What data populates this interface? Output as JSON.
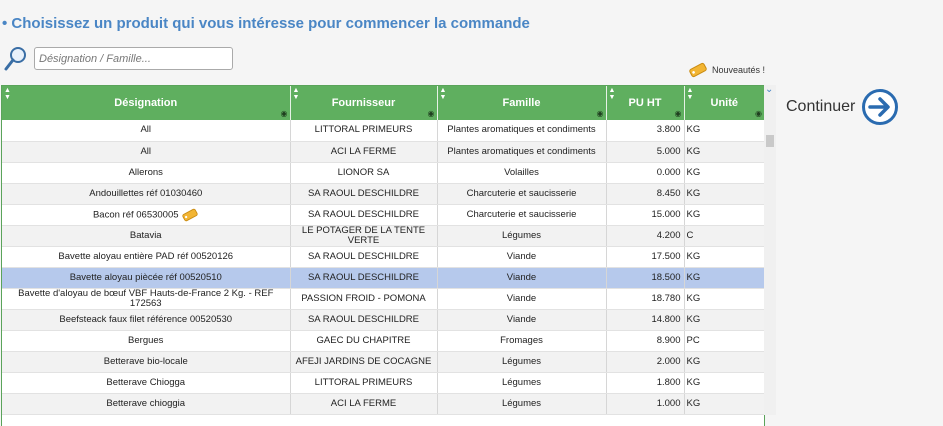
{
  "heading": "• Choisissez un produit qui vous intéresse pour commencer la commande",
  "search": {
    "placeholder": "Désignation / Famille...",
    "value": ""
  },
  "new_badge": "Nouveautés !",
  "continue_label": "Continuer",
  "columns": [
    "Désignation",
    "Fournisseur",
    "Famille",
    "PU HT",
    "Unité"
  ],
  "rows": [
    {
      "designation": "All",
      "fournisseur": "LITTORAL PRIMEURS",
      "famille": "Plantes aromatiques et condiments",
      "pu": "3.800",
      "unite": "KG",
      "new": false,
      "selected": false
    },
    {
      "designation": "All",
      "fournisseur": "ACI LA FERME",
      "famille": "Plantes aromatiques et condiments",
      "pu": "5.000",
      "unite": "KG",
      "new": false,
      "selected": false
    },
    {
      "designation": "Allerons",
      "fournisseur": "LIONOR SA",
      "famille": "Volailles",
      "pu": "0.000",
      "unite": "KG",
      "new": false,
      "selected": false
    },
    {
      "designation": "Andouillettes réf 01030460",
      "fournisseur": "SA RAOUL DESCHILDRE",
      "famille": "Charcuterie et saucisserie",
      "pu": "8.450",
      "unite": "KG",
      "new": false,
      "selected": false
    },
    {
      "designation": "Bacon réf 06530005",
      "fournisseur": "SA RAOUL DESCHILDRE",
      "famille": "Charcuterie et saucisserie",
      "pu": "15.000",
      "unite": "KG",
      "new": true,
      "selected": false
    },
    {
      "designation": "Batavia",
      "fournisseur": "LE POTAGER DE LA TENTE VERTE",
      "famille": "Légumes",
      "pu": "4.200",
      "unite": "C",
      "new": false,
      "selected": false
    },
    {
      "designation": "Bavette aloyau entière PAD réf 00520126",
      "fournisseur": "SA RAOUL DESCHILDRE",
      "famille": "Viande",
      "pu": "17.500",
      "unite": "KG",
      "new": false,
      "selected": false
    },
    {
      "designation": "Bavette aloyau piècée réf 00520510",
      "fournisseur": "SA RAOUL DESCHILDRE",
      "famille": "Viande",
      "pu": "18.500",
      "unite": "KG",
      "new": false,
      "selected": true
    },
    {
      "designation": "Bavette d'aloyau de bœuf VBF Hauts-de-France 2 Kg. - REF 172563",
      "fournisseur": "PASSION FROID - POMONA",
      "famille": "Viande",
      "pu": "18.780",
      "unite": "KG",
      "new": false,
      "selected": false
    },
    {
      "designation": "Beefsteack faux filet référence 00520530",
      "fournisseur": "SA RAOUL DESCHILDRE",
      "famille": "Viande",
      "pu": "14.800",
      "unite": "KG",
      "new": false,
      "selected": false
    },
    {
      "designation": "Bergues",
      "fournisseur": "GAEC DU CHAPITRE",
      "famille": "Fromages",
      "pu": "8.900",
      "unite": "PC",
      "new": false,
      "selected": false
    },
    {
      "designation": "Betterave bio-locale",
      "fournisseur": "AFEJI JARDINS DE COCAGNE",
      "famille": "Légumes",
      "pu": "2.000",
      "unite": "KG",
      "new": false,
      "selected": false
    },
    {
      "designation": "Betterave Chiogga",
      "fournisseur": "LITTORAL PRIMEURS",
      "famille": "Légumes",
      "pu": "1.800",
      "unite": "KG",
      "new": false,
      "selected": false
    },
    {
      "designation": "Betterave chioggia",
      "fournisseur": "ACI LA FERME",
      "famille": "Légumes",
      "pu": "1.000",
      "unite": "KG",
      "new": false,
      "selected": false
    }
  ],
  "colors": {
    "header_bg": "#5faf5f",
    "title": "#4a86c5",
    "selected_row": "#b6c9ec"
  }
}
